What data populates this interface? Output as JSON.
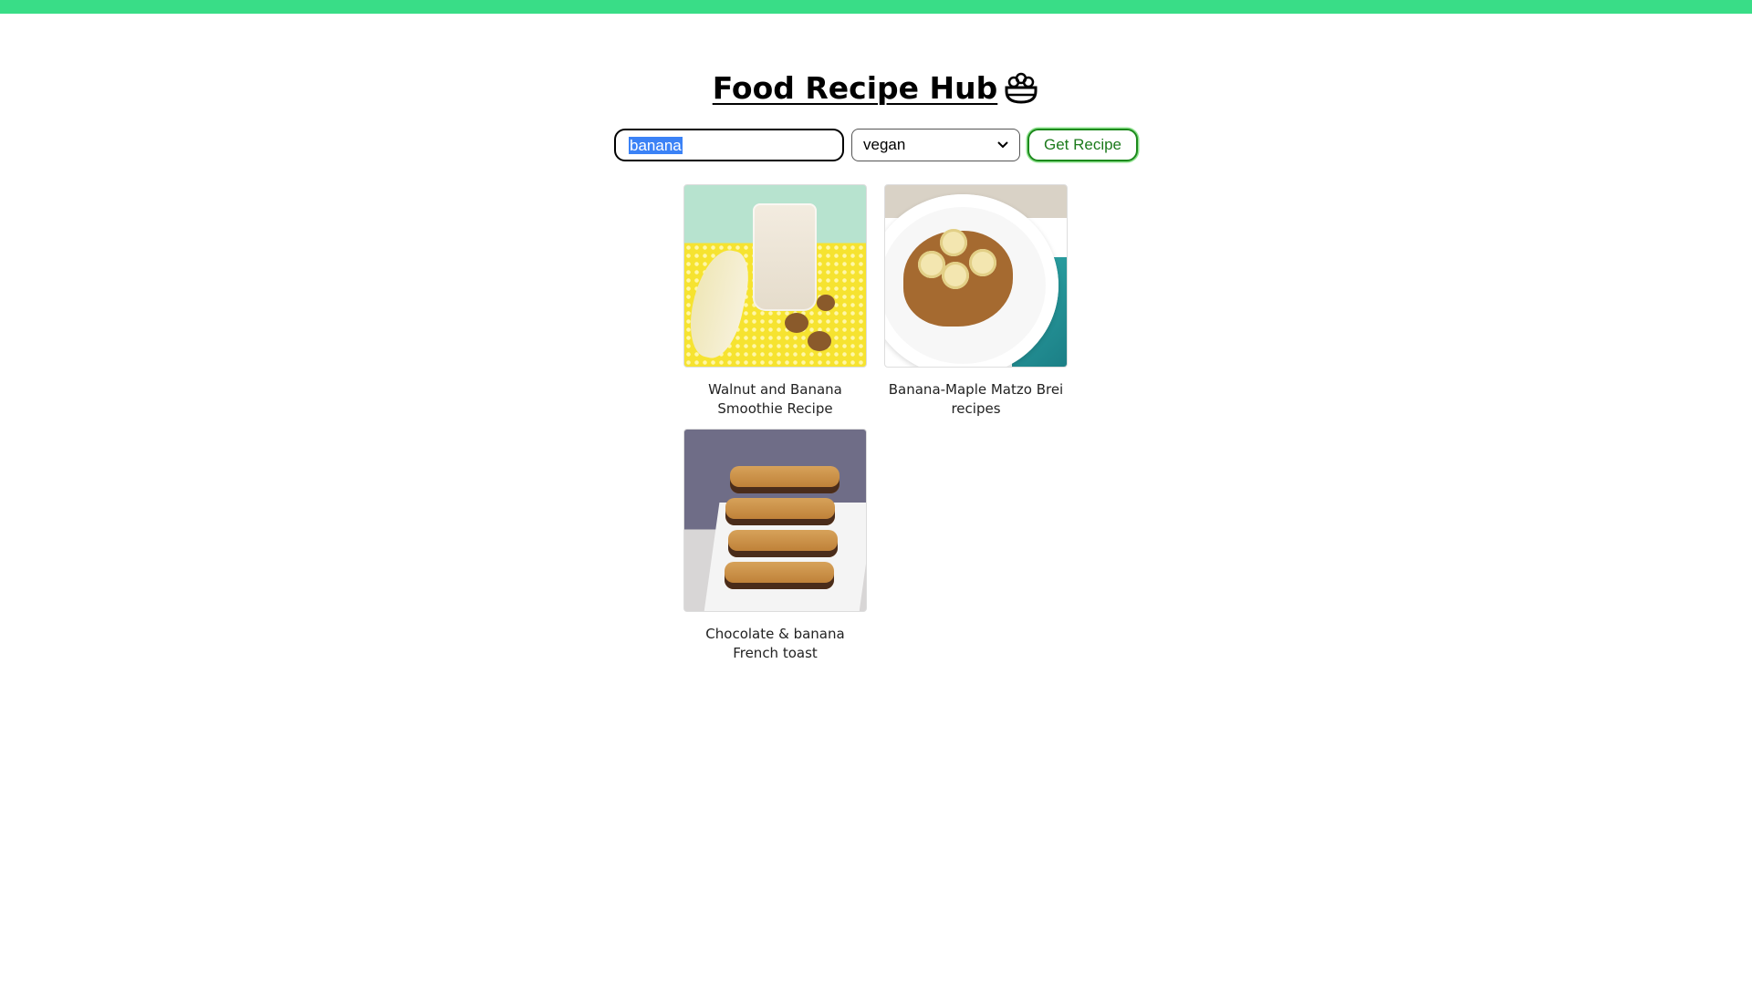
{
  "app": {
    "title": "Food Recipe Hub",
    "icon": "salad-bowl-icon",
    "accent": "#39dd87"
  },
  "search": {
    "query": "banana",
    "diet_selected": "vegan",
    "button_label": "Get Recipe"
  },
  "recipes": [
    {
      "title": "Walnut and Banana Smoothie Recipe"
    },
    {
      "title": "Banana-Maple Matzo Brei recipes"
    },
    {
      "title": "Chocolate & banana French toast"
    }
  ]
}
